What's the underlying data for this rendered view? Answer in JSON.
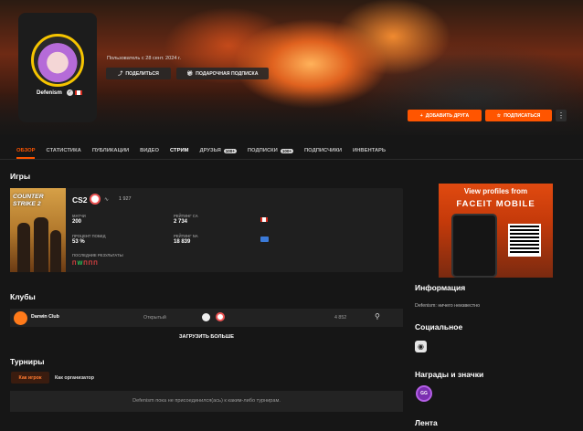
{
  "profile": {
    "username": "Defenism",
    "member_since": "Пользователь с 28 сент. 2024 г.",
    "share_label": "ПОДЕЛИТЬСЯ",
    "gift_label": "ПОДАРОЧНАЯ ПОДПИСКА",
    "add_friend_label": "ДОБАВИТЬ ДРУГА",
    "subscribe_label": "ПОДПИСАТЬСЯ",
    "more_label": "⋮"
  },
  "tabs": [
    {
      "label": "ОБЗОР",
      "badge": ""
    },
    {
      "label": "СТАТИСТИКА",
      "badge": ""
    },
    {
      "label": "ПУБЛИКАЦИИ",
      "badge": ""
    },
    {
      "label": "ВИДЕО",
      "badge": ""
    },
    {
      "label": "СТРИМ",
      "badge": ""
    },
    {
      "label": "ДРУЗЬЯ",
      "badge": "100+"
    },
    {
      "label": "ПОДПИСКИ",
      "badge": "100+"
    },
    {
      "label": "ПОДПИСЧИКИ",
      "badge": ""
    },
    {
      "label": "ИНВЕНТАРЬ",
      "badge": ""
    }
  ],
  "games": {
    "heading": "Игры",
    "cover_text": "COUNTER STRIKE 2",
    "name": "CS2",
    "elo": "1 927",
    "stats": [
      {
        "label": "МАТЧИ",
        "value": "200"
      },
      {
        "label": "РЕЙТИНГ CA",
        "value": "2 734"
      },
      {
        "label": "ПРОЦЕНТ ПОБЕД",
        "value": "53 %"
      },
      {
        "label": "РЕЙТИНГ NA",
        "value": "18 839"
      }
    ],
    "last_results_label": "ПОСЛЕДНИЕ РЕЗУЛЬТАТЫ",
    "last_results": [
      "П",
      "W",
      "П",
      "П",
      "П"
    ]
  },
  "ad": {
    "line1": "View profiles from",
    "line2": "FACEIT MOBILE"
  },
  "info": {
    "heading": "Информация",
    "text": "Defenism: ничего неизвестно"
  },
  "social": {
    "heading": "Социальное"
  },
  "awards": {
    "heading": "Награды и значки",
    "badge_text": "GG"
  },
  "feed": {
    "heading": "Лента"
  },
  "clubs": {
    "heading": "Клубы",
    "rows": [
      {
        "name": "Darwin Club",
        "type": "Открытый",
        "members": "4 852"
      }
    ],
    "load_more": "ЗАГРУЗИТЬ БОЛЬШЕ"
  },
  "tournaments": {
    "heading": "Турниры",
    "tab_player": "Как игрок",
    "tab_organizer": "Как организатор",
    "empty": "Defenism пока не присоединился(ась) к каким-либо турнирам."
  },
  "colors": {
    "accent": "#ff5500",
    "bg": "#161616"
  }
}
